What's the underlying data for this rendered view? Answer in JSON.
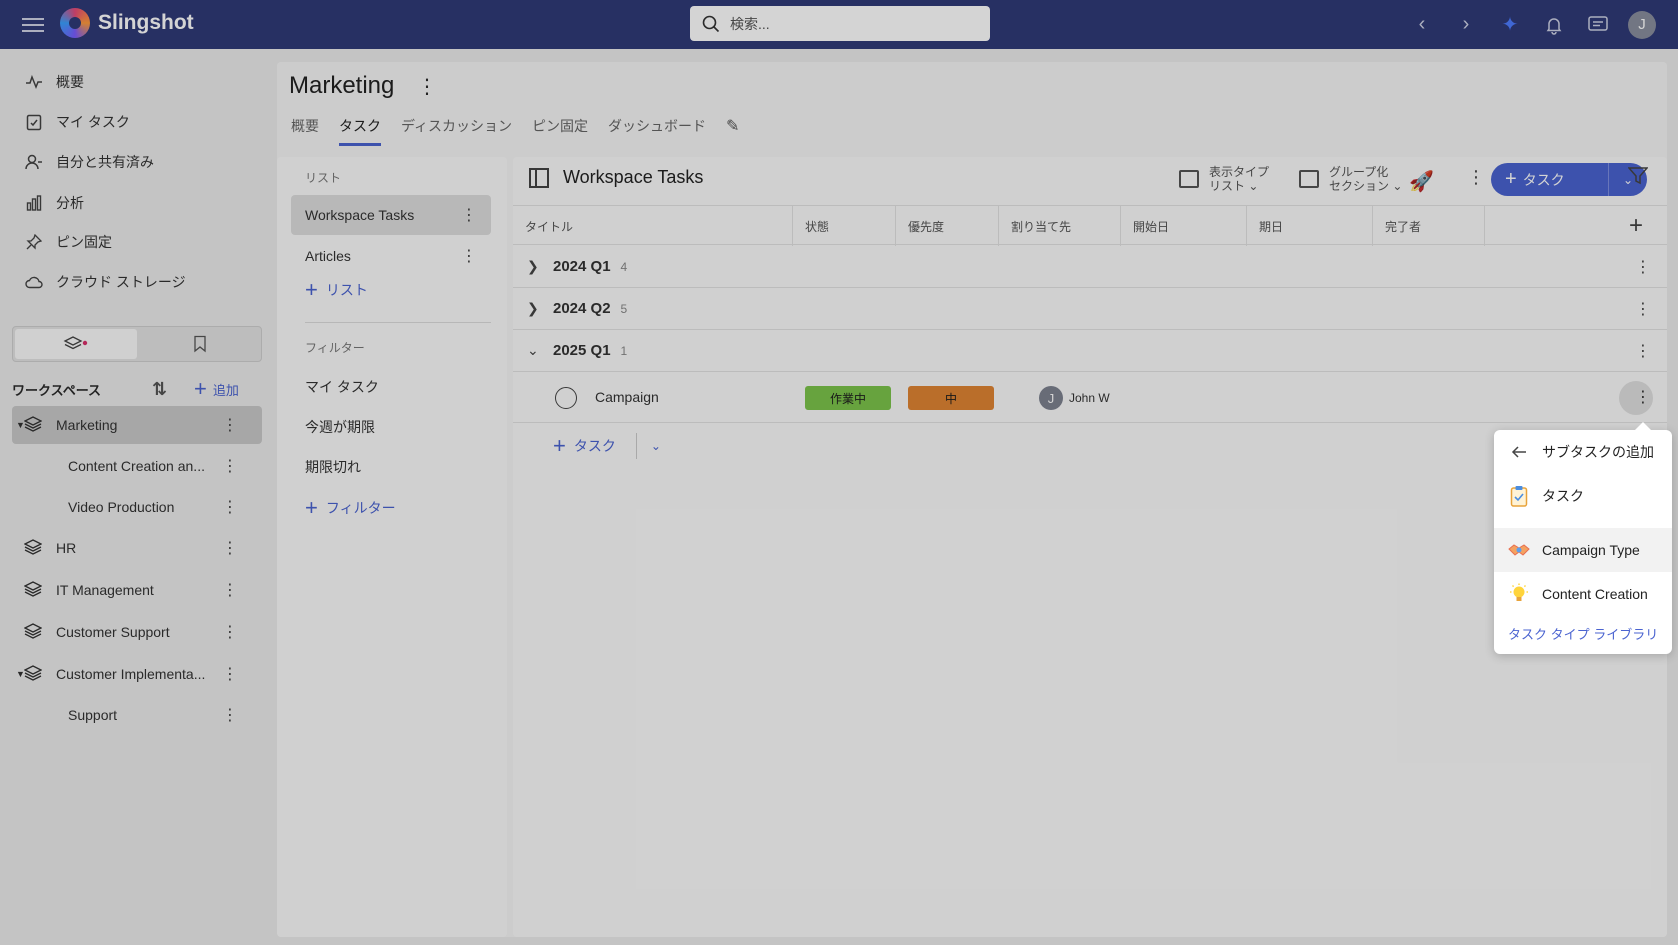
{
  "topbar": {
    "app_name": "Slingshot",
    "search_placeholder": "検索...",
    "user_initial": "J"
  },
  "nav": {
    "items": [
      {
        "label": "概要",
        "icon": "activity-icon"
      },
      {
        "label": "マイ タスク",
        "icon": "clipboard-check-icon"
      },
      {
        "label": "自分と共有済み",
        "icon": "user-share-icon"
      },
      {
        "label": "分析",
        "icon": "bar-chart-icon"
      },
      {
        "label": "ピン固定",
        "icon": "pin-icon"
      },
      {
        "label": "クラウド ストレージ",
        "icon": "cloud-icon"
      }
    ]
  },
  "workspaces": {
    "header": "ワークスペース",
    "add_label": "追加",
    "items": [
      {
        "label": "Marketing",
        "sub": false,
        "expanded": true,
        "active": true
      },
      {
        "label": "Content Creation an...",
        "sub": true
      },
      {
        "label": "Video Production",
        "sub": true
      },
      {
        "label": "HR",
        "sub": false
      },
      {
        "label": "IT Management",
        "sub": false
      },
      {
        "label": "Customer Support",
        "sub": false
      },
      {
        "label": "Customer Implementa...",
        "sub": false,
        "expanded": true
      },
      {
        "label": "Support",
        "sub": true
      }
    ]
  },
  "page": {
    "title": "Marketing",
    "tabs": [
      {
        "label": "概要",
        "active": false
      },
      {
        "label": "タスク",
        "active": true
      },
      {
        "label": "ディスカッション",
        "active": false
      },
      {
        "label": "ピン固定",
        "active": false
      },
      {
        "label": "ダッシュボード",
        "active": false
      }
    ]
  },
  "lists": {
    "section_label": "リスト",
    "items": [
      "Workspace Tasks",
      "Articles"
    ],
    "add_list_label": "リスト",
    "filters_label": "フィルター",
    "filters": [
      "マイ タスク",
      "今週が期限",
      "期限切れ"
    ],
    "add_filter_label": "フィルター"
  },
  "board": {
    "title": "Workspace Tasks",
    "view_type_label": "表示タイプ",
    "view_type_value": "リスト",
    "group_label": "グループ化",
    "group_value": "セクション",
    "task_button_label": "タスク",
    "columns": [
      "タイトル",
      "状態",
      "優先度",
      "割り当て先",
      "開始日",
      "期日",
      "完了者"
    ],
    "groups": [
      {
        "name": "2024 Q1",
        "count": "4",
        "expanded": false
      },
      {
        "name": "2024 Q2",
        "count": "5",
        "expanded": false
      },
      {
        "name": "2025 Q1",
        "count": "1",
        "expanded": true
      }
    ],
    "task": {
      "name": "Campaign",
      "status": "作業中",
      "status_color": "#7cc54b",
      "priority": "中",
      "priority_color": "#e08533",
      "assignee_initial": "J",
      "assignee": "John W"
    },
    "add_task_label": "タスク"
  },
  "popup": {
    "back_label": "サブタスクの追加",
    "items": [
      {
        "label": "タスク",
        "icon": "clipboard-task-icon"
      },
      {
        "label": "Campaign Type",
        "icon": "handshake-icon"
      },
      {
        "label": "Content Creation",
        "icon": "lightbulb-icon"
      }
    ],
    "library_link": "タスク タイプ ライブラリ"
  }
}
